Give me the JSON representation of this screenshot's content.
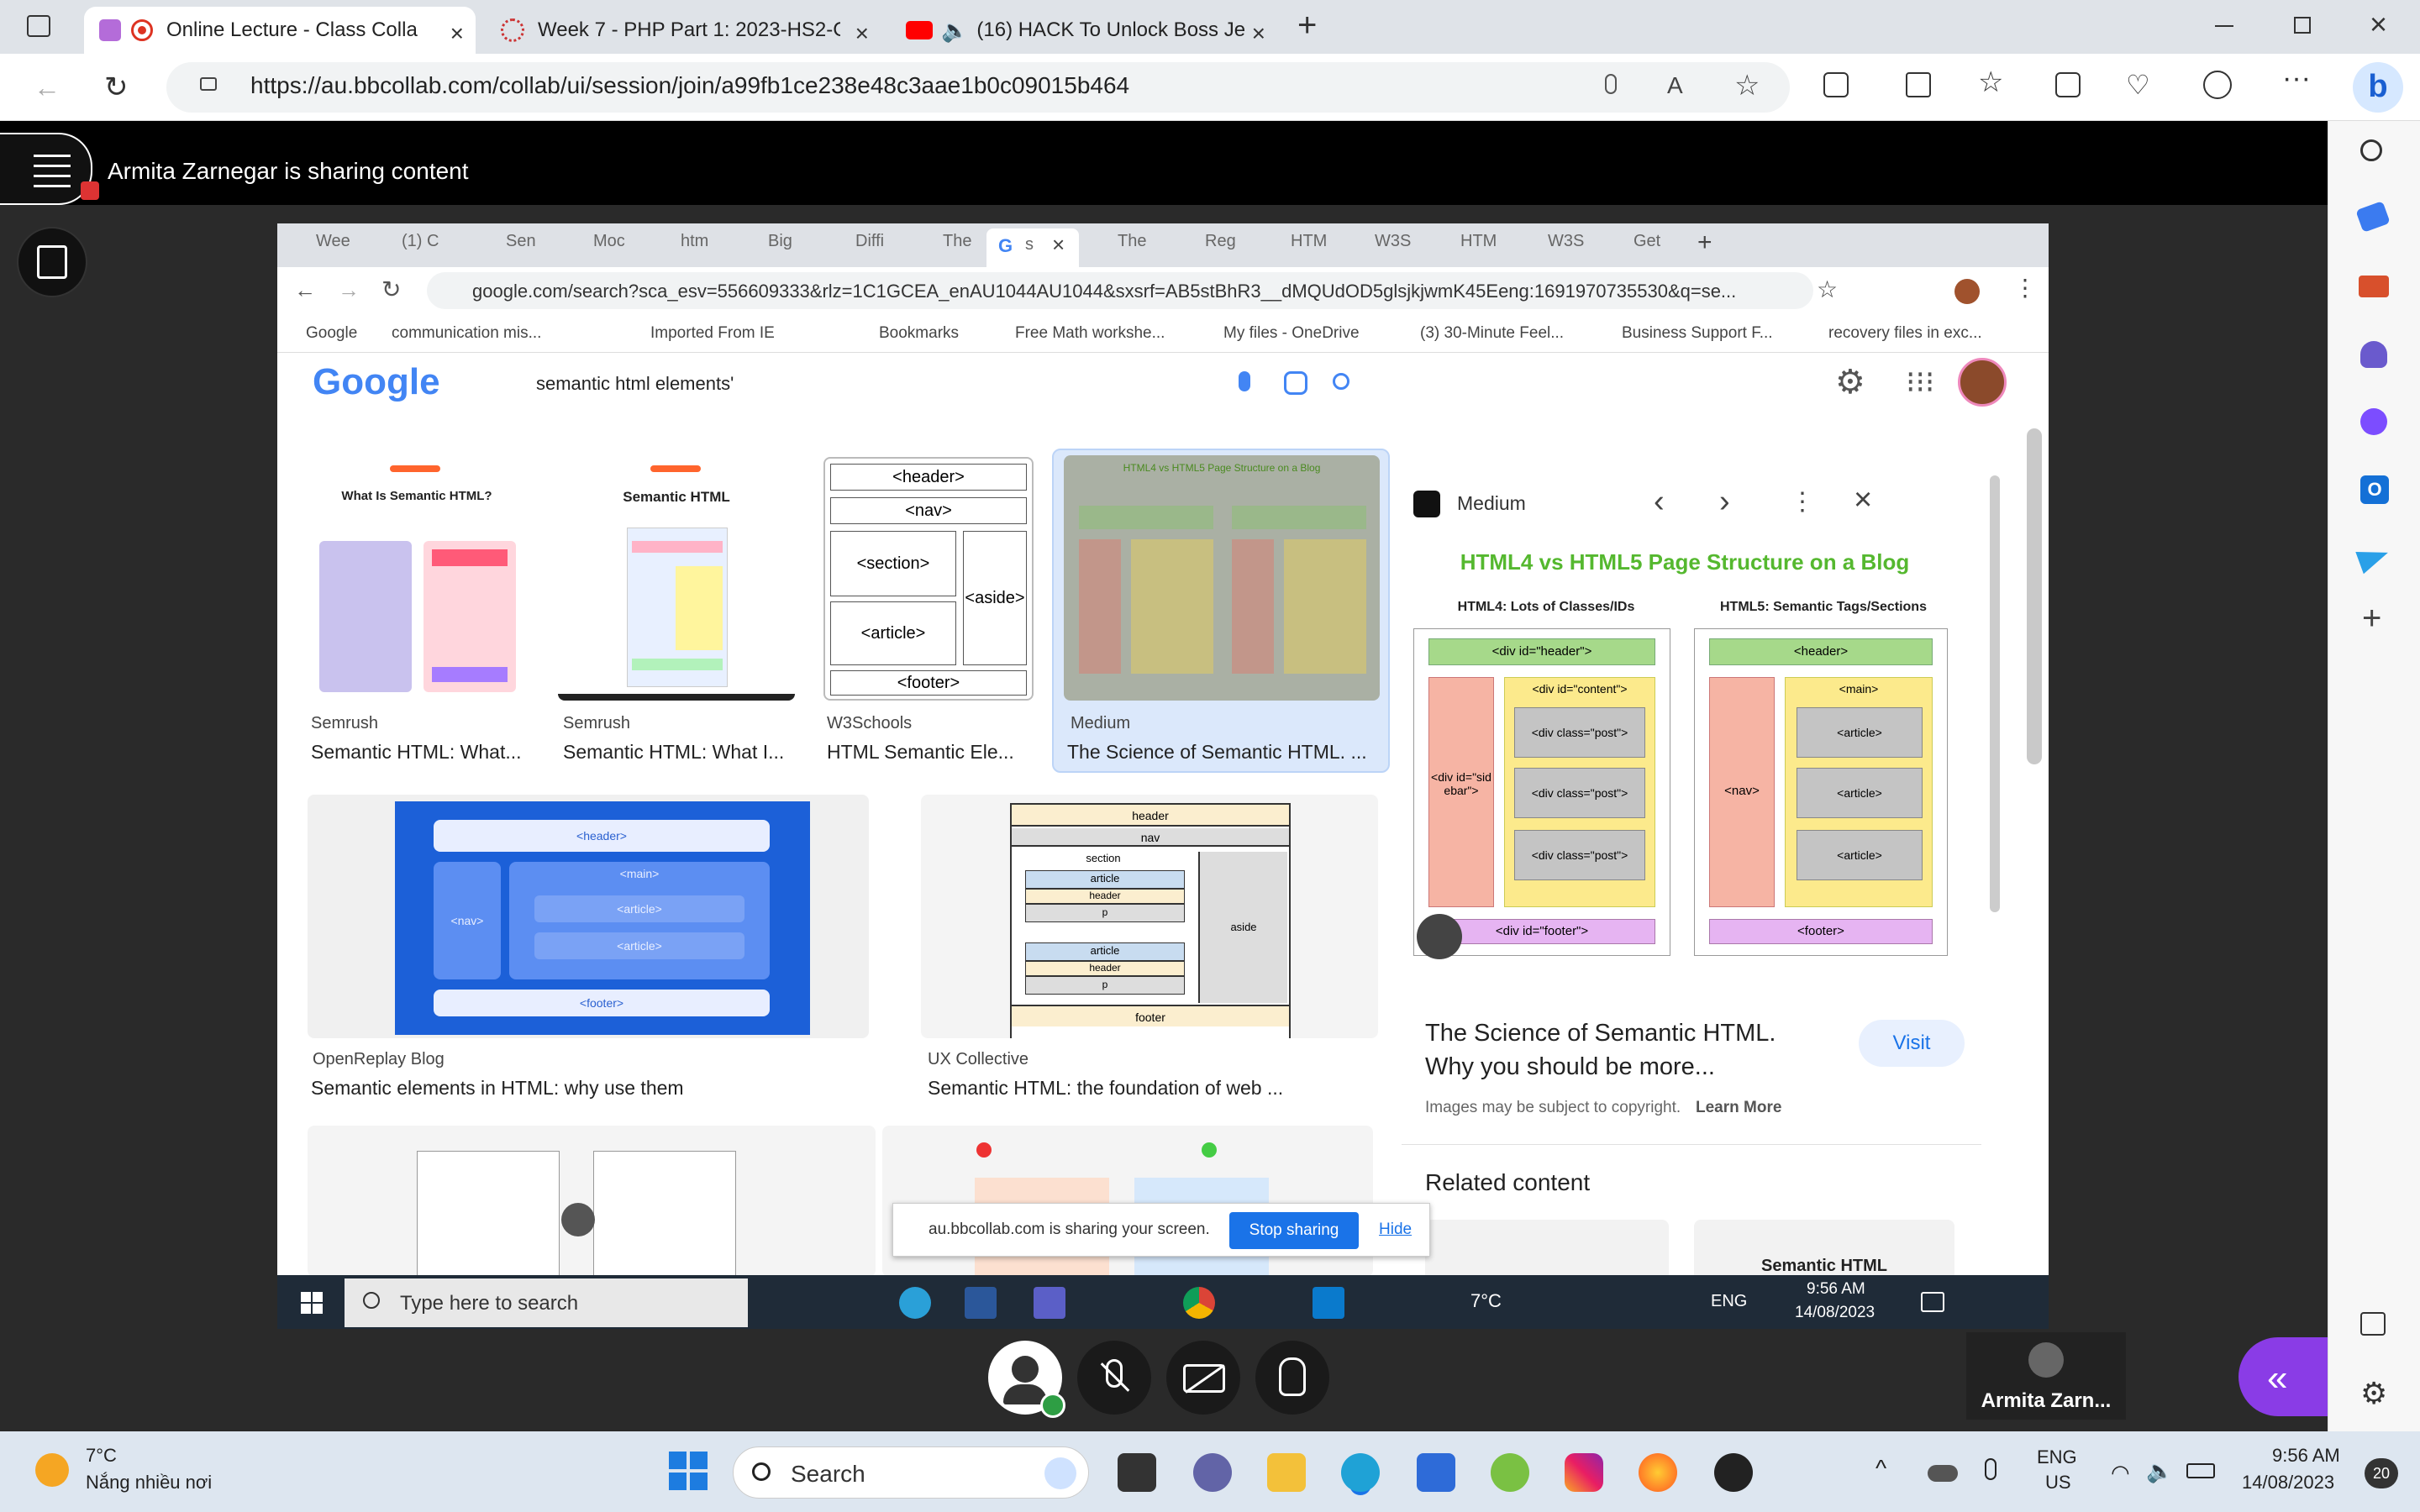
{
  "browser": {
    "tabs": [
      {
        "title": "Online Lecture - Class Collab",
        "active": true
      },
      {
        "title": "Week 7 - PHP Part 1: 2023-HS2-C",
        "active": false
      },
      {
        "title": "(16) HACK To Unlock Boss Je",
        "active": false
      }
    ],
    "url": "https://au.bbcollab.com/collab/ui/session/join/a99fb1ce238e48c3aae1b0c09015b464"
  },
  "collab": {
    "sharing_text": "Armita Zarnegar is sharing content",
    "participant_name": "Armita Zarn..."
  },
  "shared_browser": {
    "tabs": [
      "Wee",
      "(1) C",
      "Sen",
      "Moc",
      "htm",
      "Big",
      "Diffi",
      "The",
      "s",
      "The",
      "Reg",
      "HTM",
      "W3S",
      "HTM",
      "W3S",
      "Get"
    ],
    "url": "google.com/search?sca_esv=556609333&rlz=1C1GCEA_enAU1044AU1044&sxsrf=AB5stBhR3__dMQUdOD5glsjkjwmK45Eeng:1691970735530&q=se...",
    "bookmarks": [
      "Google",
      "communication mis...",
      "Imported From IE",
      "Bookmarks",
      "Free Math workshe...",
      "My files - OneDrive",
      "(3) 30-Minute Feel...",
      "Business Support F...",
      "recovery files in exc..."
    ],
    "search_query": "semantic html elements'",
    "logo": "Google",
    "results_row1": [
      {
        "source": "Semrush",
        "caption": "Semantic HTML: What..."
      },
      {
        "source": "Semrush",
        "caption": "Semantic HTML: What I..."
      },
      {
        "source": "W3Schools",
        "caption": "HTML Semantic Ele..."
      },
      {
        "source": "Medium",
        "caption": "The Science of Semantic HTML. ..."
      }
    ],
    "results_row2": [
      {
        "source": "OpenReplay Blog",
        "caption": "Semantic elements in HTML: why use them"
      },
      {
        "source": "UX Collective",
        "caption": "Semantic HTML: the foundation of web ..."
      }
    ],
    "thumb_w3": {
      "header": "<header>",
      "nav": "<nav>",
      "section": "<section>",
      "aside": "<aside>",
      "article": "<article>",
      "footer": "<footer>"
    },
    "thumb_semrush1": {
      "title": "What Is Semantic HTML?"
    },
    "thumb_semrush2": {
      "title": "Semantic HTML"
    },
    "thumb_medium_small": {
      "title": "HTML4 vs HTML5 Page Structure on a Blog"
    },
    "thumb_openreplay": {
      "header": "<header>",
      "nav": "<nav>",
      "main": "<main>",
      "article1": "<article>",
      "article2": "<article>",
      "footer": "<footer>"
    },
    "thumb_ux": {
      "header": "header",
      "nav": "nav",
      "section": "section",
      "article": "article",
      "p": "p",
      "aside": "aside",
      "footer": "footer"
    },
    "panel": {
      "source": "Medium",
      "image_title": "HTML4 vs HTML5 Page Structure on a Blog",
      "left_heading": "HTML4: Lots of Classes/IDs",
      "right_heading": "HTML5: Semantic Tags/Sections",
      "left_boxes": {
        "header": "<div id=\"header\">",
        "sidebar": "<div id=\"sidebar\">",
        "content": "<div id=\"content\">",
        "post": "<div class=\"post\">",
        "footer": "<div id=\"footer\">"
      },
      "right_boxes": {
        "header": "<header>",
        "nav": "<nav>",
        "main": "<main>",
        "article": "<article>",
        "footer": "<footer>"
      },
      "title": "The Science of Semantic HTML. Why you should be more...",
      "visit_label": "Visit",
      "copyright": "Images may be subject to copyright.",
      "learn_more": "Learn More",
      "related": "Related content",
      "related_thumb": "Semantic HTML"
    },
    "share_notice": "au.bbcollab.com is sharing your screen.",
    "stop_sharing": "Stop sharing",
    "hide": "Hide",
    "taskbar": {
      "search": "Type here to search",
      "temp": "7°C",
      "lang": "ENG",
      "time": "9:56 AM",
      "date": "14/08/2023"
    }
  },
  "taskbar": {
    "weather_temp": "7°C",
    "weather_desc": "Nắng nhiều nơi",
    "search": "Search",
    "lang": "ENG",
    "region": "US",
    "time": "9:56 AM",
    "date": "14/08/2023",
    "notif_count": "20"
  },
  "colors": {
    "accent": "#1a73e8",
    "collab_purple": "#8a3ce6",
    "tab_bg": "#dfe3e8"
  }
}
